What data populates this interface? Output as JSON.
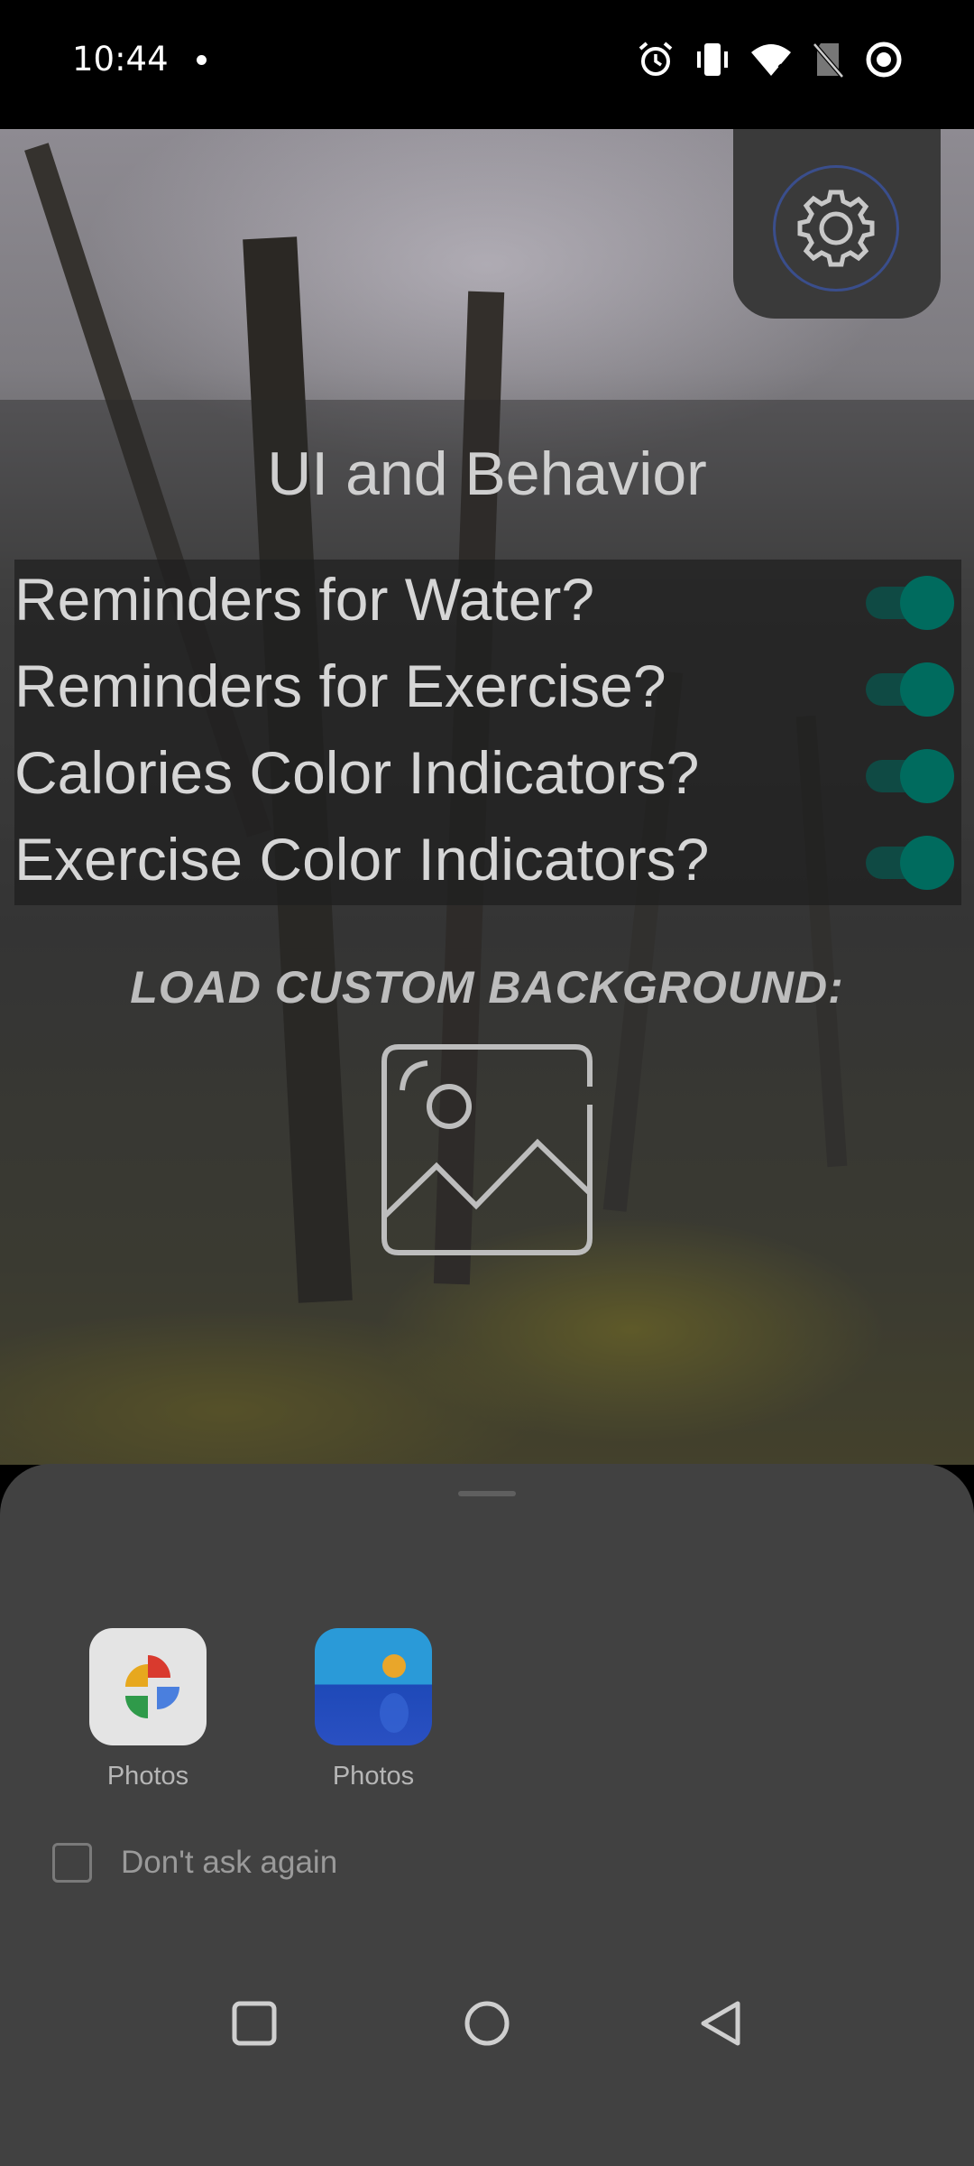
{
  "status_bar": {
    "time": "10:44"
  },
  "settings": {
    "icon": "gear-icon"
  },
  "section": {
    "title": "UI and Behavior"
  },
  "toggles": [
    {
      "label": "Reminders for Water?",
      "on": true
    },
    {
      "label": "Reminders for Exercise?",
      "on": true
    },
    {
      "label": "Calories Color Indicators?",
      "on": true
    },
    {
      "label": "Exercise Color Indicators?",
      "on": true
    }
  ],
  "background_loader": {
    "label": "LOAD CUSTOM BACKGROUND:",
    "icon": "image-placeholder-icon"
  },
  "chooser": {
    "apps": [
      {
        "label": "Photos",
        "icon": "google-photos-icon"
      },
      {
        "label": "Photos",
        "icon": "gallery-photos-icon"
      }
    ],
    "dont_ask_label": "Don't ask again",
    "dont_ask_checked": false
  },
  "colors": {
    "accent": "#006b5e",
    "sheet": "#414141"
  }
}
